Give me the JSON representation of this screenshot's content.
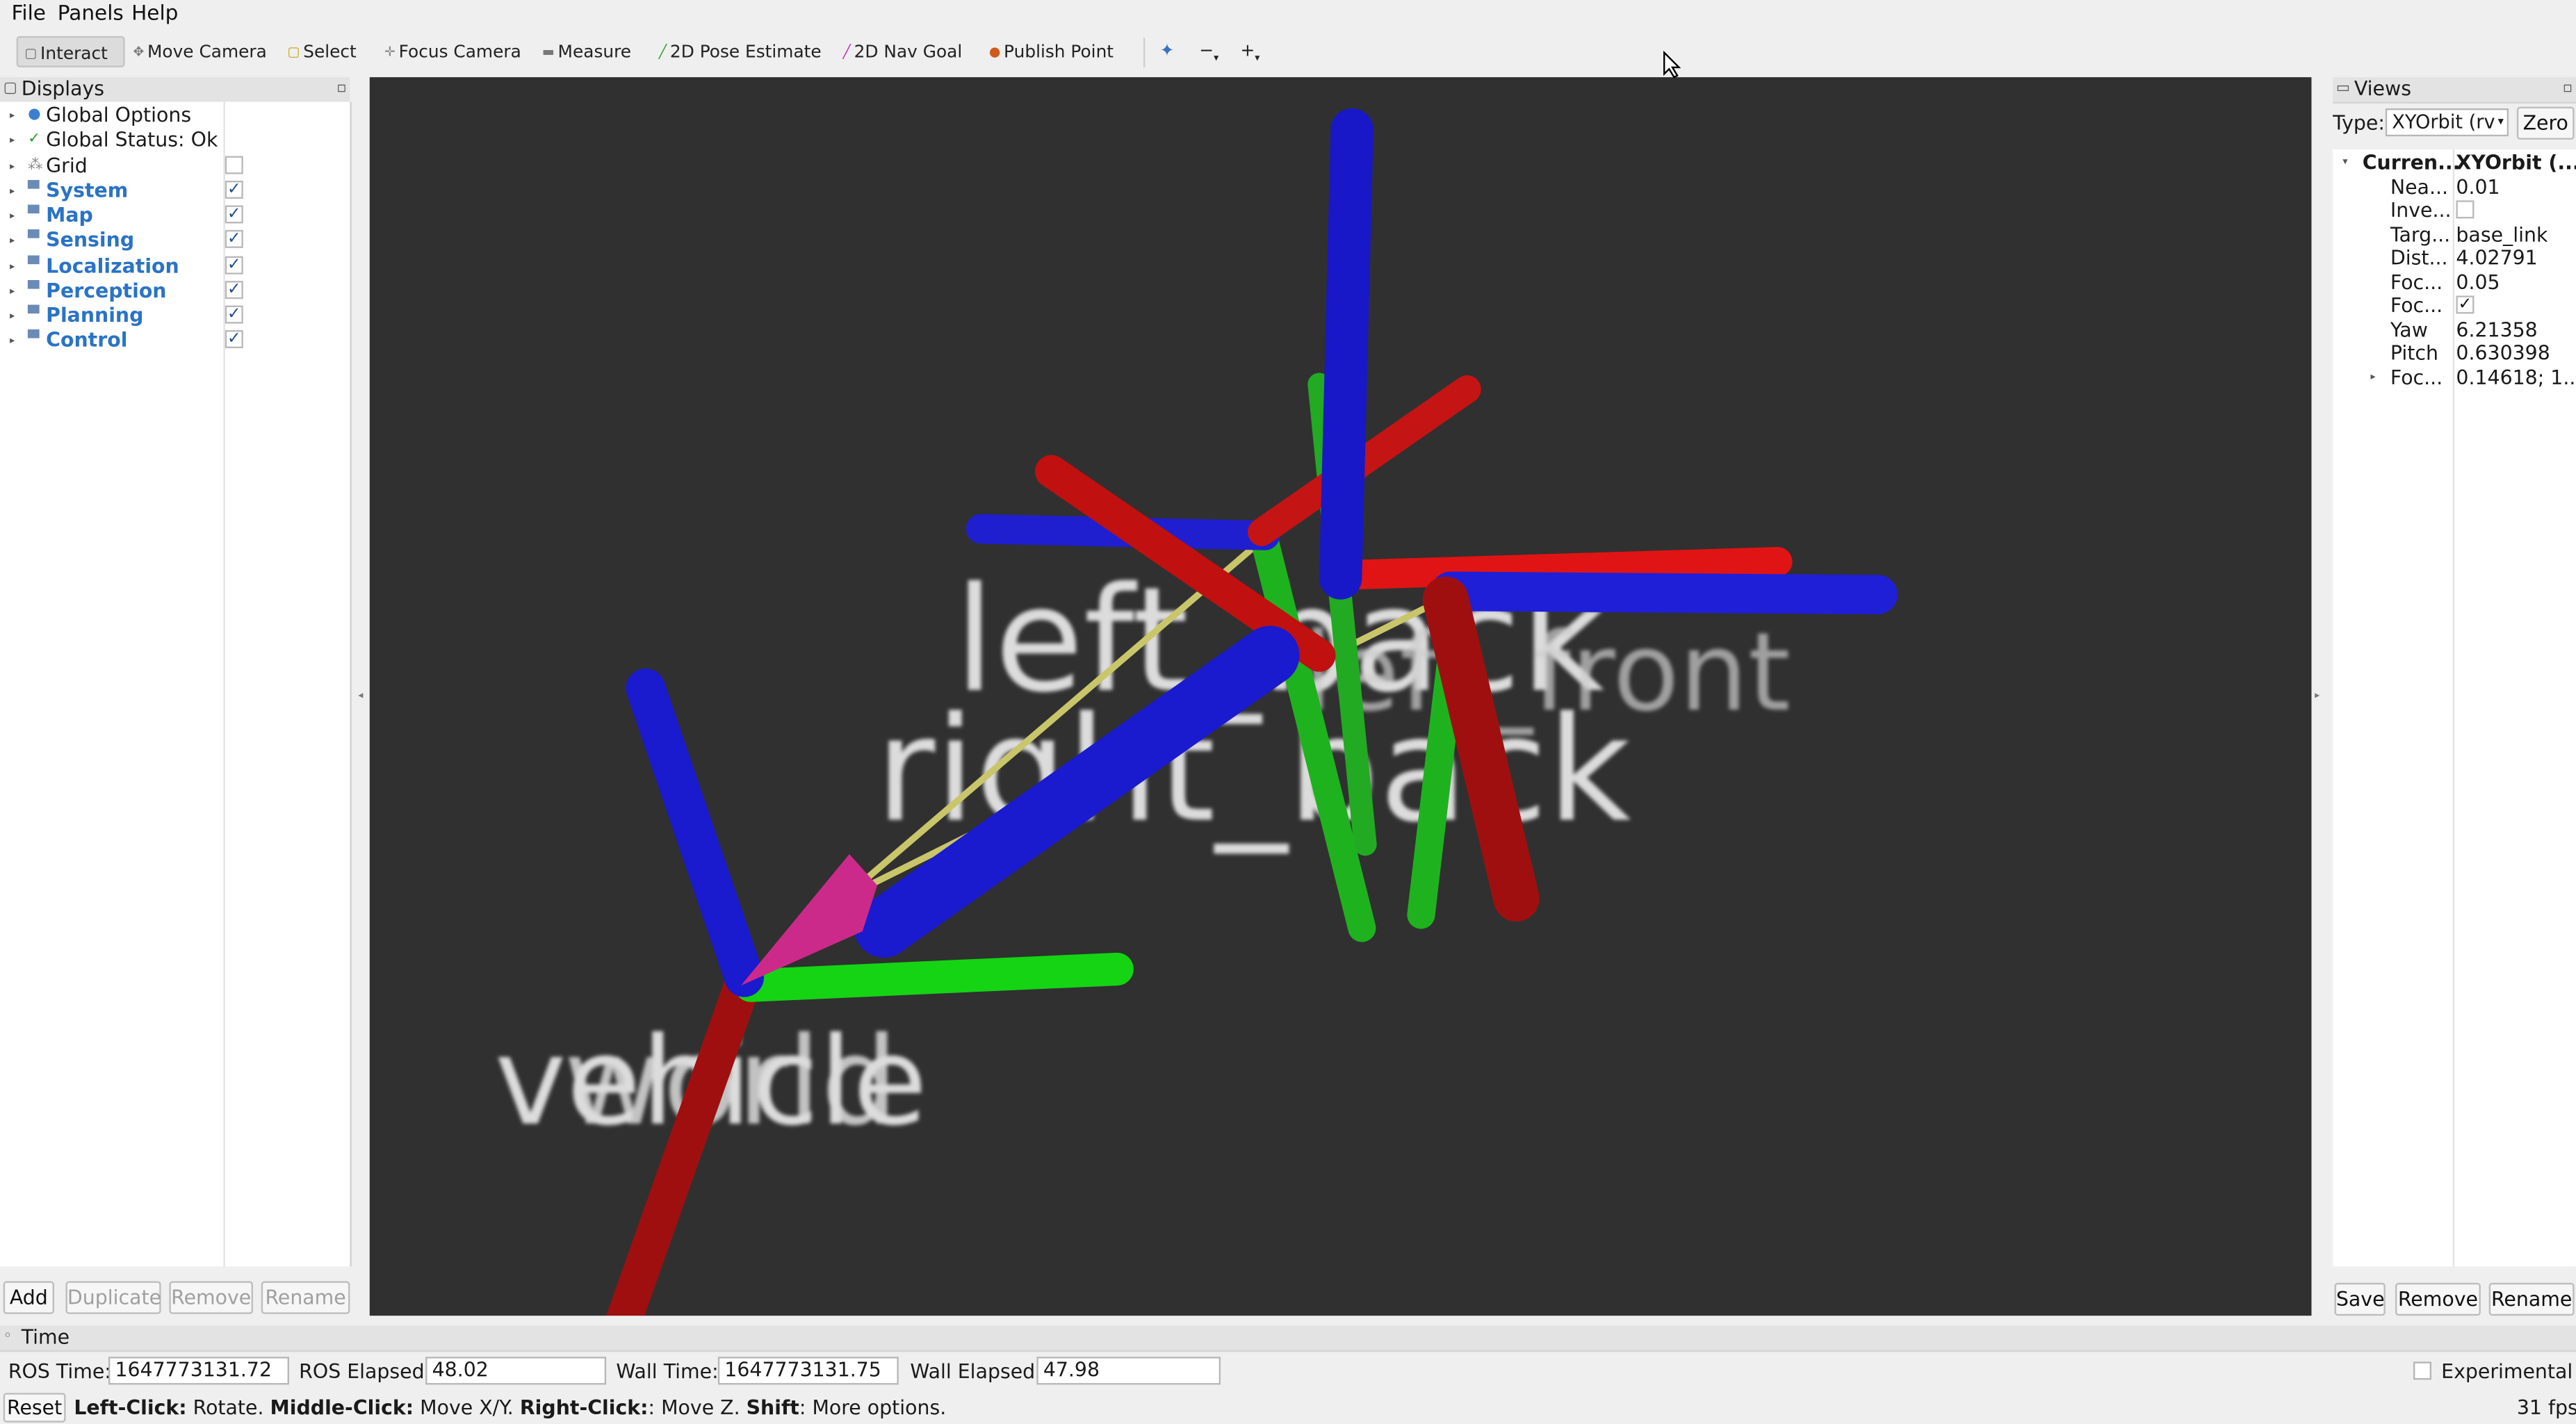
{
  "menubar": {
    "file": "File",
    "panels": "Panels",
    "help": "Help"
  },
  "toolbar": {
    "interact": "Interact",
    "move_camera": "Move Camera",
    "select": "Select",
    "focus_camera": "Focus Camera",
    "measure": "Measure",
    "pose_estimate": "2D Pose Estimate",
    "nav_goal": "2D Nav Goal",
    "publish_point": "Publish Point",
    "zoom_minus": "−",
    "zoom_plus": "+"
  },
  "displays": {
    "title": "Displays",
    "items": [
      {
        "label": "Global Options",
        "icon": "dot-icon",
        "checked": null,
        "group": false
      },
      {
        "label": "Global Status: Ok",
        "icon": "check-icon",
        "checked": null,
        "group": false
      },
      {
        "label": "Grid",
        "icon": "grid-icon",
        "checked": false,
        "group": false
      },
      {
        "label": "System",
        "icon": "folder-icon",
        "checked": true,
        "group": true
      },
      {
        "label": "Map",
        "icon": "folder-icon",
        "checked": true,
        "group": true
      },
      {
        "label": "Sensing",
        "icon": "folder-icon",
        "checked": true,
        "group": true
      },
      {
        "label": "Localization",
        "icon": "folder-icon",
        "checked": true,
        "group": true
      },
      {
        "label": "Perception",
        "icon": "folder-icon",
        "checked": true,
        "group": true
      },
      {
        "label": "Planning",
        "icon": "folder-icon",
        "checked": true,
        "group": true
      },
      {
        "label": "Control",
        "icon": "folder-icon",
        "checked": true,
        "group": true
      }
    ],
    "buttons": {
      "add": "Add",
      "duplicate": "Duplicate",
      "remove": "Remove",
      "rename": "Rename"
    }
  },
  "viewport": {
    "labels": {
      "left_back": "left_back",
      "right_back": "right_back",
      "ghost_front": "left_front",
      "vehicle": "vehicle",
      "world": "world"
    }
  },
  "views": {
    "title": "Views",
    "type_label": "Type:",
    "type_value": "XYOrbit (rv",
    "zero": "Zero",
    "current_key": "Curren...",
    "current_value": "XYOrbit (...",
    "props": [
      {
        "key": "Nea...",
        "value": "0.01",
        "checkbox": false
      },
      {
        "key": "Inve...",
        "value": "",
        "checkbox": true,
        "checked": false
      },
      {
        "key": "Targ...",
        "value": "base_link",
        "checkbox": false
      },
      {
        "key": "Dist...",
        "value": "4.02791",
        "checkbox": false
      },
      {
        "key": "Foc...",
        "value": "0.05",
        "checkbox": false
      },
      {
        "key": "Foc...",
        "value": "",
        "checkbox": true,
        "checked": true
      },
      {
        "key": "Yaw",
        "value": "6.21358",
        "checkbox": false
      },
      {
        "key": "Pitch",
        "value": "0.630398",
        "checkbox": false
      },
      {
        "key": "Foc...",
        "value": "0.14618; 1...",
        "checkbox": false,
        "expandable": true
      }
    ],
    "buttons": {
      "save": "Save",
      "remove": "Remove",
      "rename": "Rename"
    }
  },
  "time": {
    "title": "Time",
    "ros_time_label": "ROS Time:",
    "ros_time": "1647773131.72",
    "ros_elapsed_label": "ROS Elapsed:",
    "ros_elapsed": "48.02",
    "wall_time_label": "Wall Time:",
    "wall_time": "1647773131.75",
    "wall_elapsed_label": "Wall Elapsed:",
    "wall_elapsed": "47.98",
    "experimental": "Experimental"
  },
  "status": {
    "reset": "Reset",
    "left_click": "Left-Click:",
    "left_click_desc": " Rotate. ",
    "middle_click": "Middle-Click:",
    "middle_click_desc": " Move X/Y. ",
    "right_click": "Right-Click:",
    "right_click_desc": ": Move Z. ",
    "shift": "Shift",
    "shift_desc": ": More options.",
    "fps": "31 fps"
  }
}
